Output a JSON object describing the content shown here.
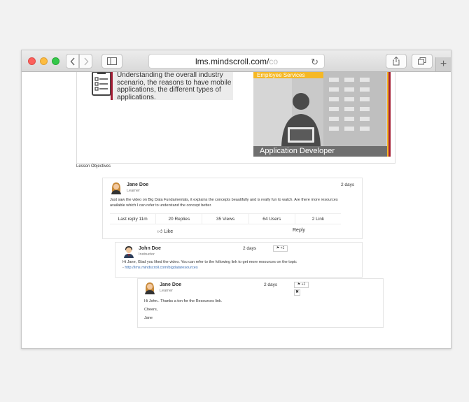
{
  "browser": {
    "url_main": "lms.mindscroll.com/",
    "url_faded": "co"
  },
  "banner": {
    "objective_text": "Understanding the overall industry scenario, the reasons to have mobile applications, the different types of applications.",
    "promo_tag": "Employee Services",
    "promo_label": "Application Developer",
    "caption": "Lesson Objectives"
  },
  "post": {
    "author": "Jane Doe",
    "role": "Learner",
    "time": "2 days",
    "text": "Just saw the video on Big Data Fundamentals, it explains the concepts beautifully and is really fun to watch. Are there more resources available which I can refer to understand the concept better.",
    "stats": [
      "Last reply 11m",
      "20 Replies",
      "35 Views",
      "64 Users",
      "2 Link"
    ],
    "like_label": "Like",
    "reply_label": "Reply"
  },
  "replies": [
    {
      "author": "John Doe",
      "role": "Instructor",
      "time": "2 days",
      "flag_count": "+1",
      "text_line1": "Hi Jane, Glad you liked the video. You can refer to the following link to get more resources on the topic",
      "text_link_prefix": "- ",
      "text_link": "http://lms.mindscroll.com/bigdataresources"
    },
    {
      "author": "Jane Doe",
      "role": "Learner",
      "time": "2 days",
      "flag_count": "+1",
      "text_line1": "Hi John.. Thanks a ton for the Resources link.",
      "text_line2": "Cheers,",
      "text_line3": "Jane"
    }
  ],
  "colors": {
    "accent_red": "#a31c34",
    "accent_yellow": "#f5b825",
    "link_blue": "#3a6fb5"
  }
}
